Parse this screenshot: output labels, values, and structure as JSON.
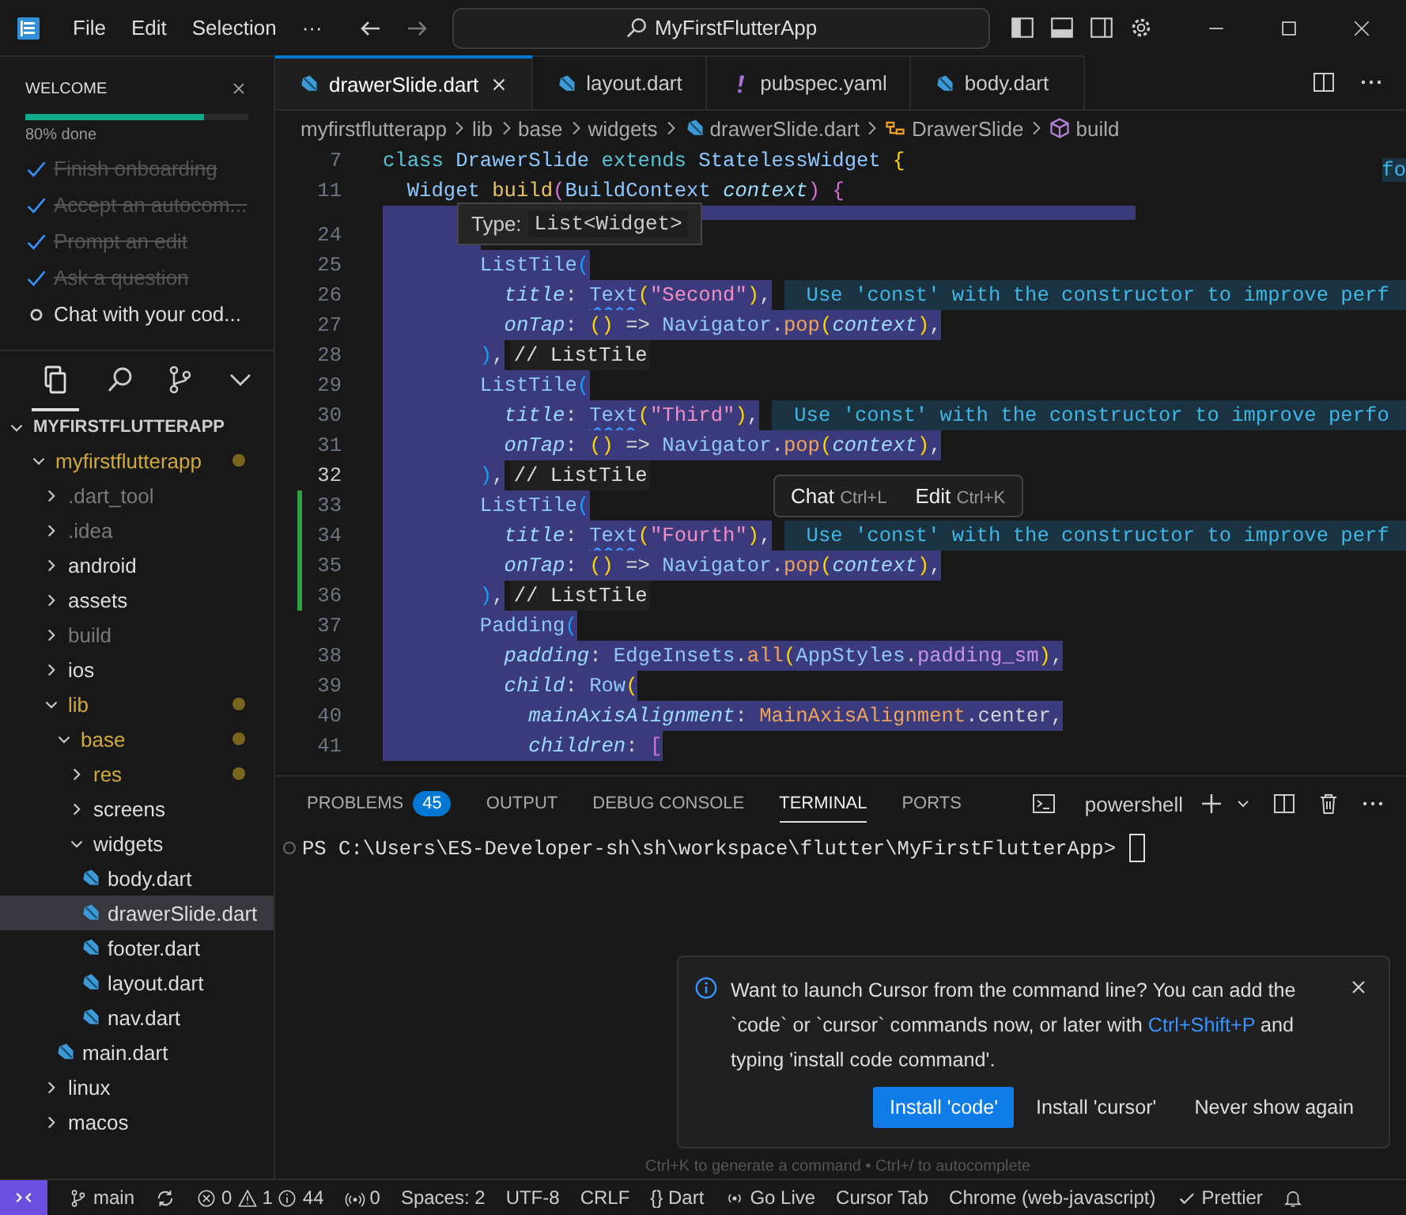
{
  "titlebar": {
    "menu": [
      "File",
      "Edit",
      "Selection",
      "···"
    ],
    "search": "MyFirstFlutterApp"
  },
  "welcome": {
    "title": "WELCOME",
    "level": 0.8,
    "progress_text": "80% done",
    "steps": [
      {
        "label": "Finish onboarding",
        "done": true
      },
      {
        "label": "Accept an autocom...",
        "done": true
      },
      {
        "label": "Prompt an edit",
        "done": true
      },
      {
        "label": "Ask a question",
        "done": true
      },
      {
        "label": "Chat with your cod...",
        "done": false
      }
    ]
  },
  "activity": [
    {
      "kind": "files",
      "selected": true
    },
    {
      "kind": "search",
      "selected": false
    },
    {
      "kind": "git",
      "selected": false
    },
    {
      "kind": "more",
      "selected": false
    }
  ],
  "explorer": {
    "root": "MYFIRSTFLUTTERAPP",
    "tree": [
      {
        "label": "myfirstflutterapp",
        "kind": "folder",
        "expanded": true,
        "modified": true,
        "dimmed": false,
        "selected": false,
        "children": [
          {
            "label": ".dart_tool",
            "kind": "folder",
            "expanded": false,
            "modified": false,
            "dimmed": true,
            "selected": false
          },
          {
            "label": ".idea",
            "kind": "folder",
            "expanded": false,
            "modified": false,
            "dimmed": true,
            "selected": false
          },
          {
            "label": "android",
            "kind": "folder",
            "expanded": false,
            "modified": false,
            "dimmed": false,
            "selected": false
          },
          {
            "label": "assets",
            "kind": "folder",
            "expanded": false,
            "modified": false,
            "dimmed": false,
            "selected": false
          },
          {
            "label": "build",
            "kind": "folder",
            "expanded": false,
            "modified": false,
            "dimmed": true,
            "selected": false
          },
          {
            "label": "ios",
            "kind": "folder",
            "expanded": false,
            "modified": false,
            "dimmed": false,
            "selected": false
          },
          {
            "label": "lib",
            "kind": "folder",
            "expanded": true,
            "modified": true,
            "dimmed": false,
            "selected": false,
            "children": [
              {
                "label": "base",
                "kind": "folder",
                "expanded": true,
                "modified": true,
                "dimmed": false,
                "selected": false,
                "children": [
                  {
                    "label": "res",
                    "kind": "folder",
                    "expanded": false,
                    "modified": true,
                    "dimmed": false,
                    "selected": false
                  },
                  {
                    "label": "screens",
                    "kind": "folder",
                    "expanded": false,
                    "modified": false,
                    "dimmed": false,
                    "selected": false
                  },
                  {
                    "label": "widgets",
                    "kind": "folder",
                    "expanded": true,
                    "modified": false,
                    "dimmed": false,
                    "selected": false,
                    "children": [
                      {
                        "label": "body.dart",
                        "kind": "file",
                        "modified": false,
                        "dimmed": false,
                        "selected": false
                      },
                      {
                        "label": "drawerSlide.dart",
                        "kind": "file",
                        "modified": false,
                        "dimmed": false,
                        "selected": true
                      },
                      {
                        "label": "footer.dart",
                        "kind": "file",
                        "modified": false,
                        "dimmed": false,
                        "selected": false
                      },
                      {
                        "label": "layout.dart",
                        "kind": "file",
                        "modified": false,
                        "dimmed": false,
                        "selected": false
                      },
                      {
                        "label": "nav.dart",
                        "kind": "file",
                        "modified": false,
                        "dimmed": false,
                        "selected": false
                      }
                    ]
                  }
                ]
              },
              {
                "label": "main.dart",
                "kind": "file",
                "modified": false,
                "dimmed": false,
                "selected": false
              }
            ]
          },
          {
            "label": "linux",
            "kind": "folder",
            "expanded": false,
            "modified": false,
            "dimmed": false,
            "selected": false
          },
          {
            "label": "macos",
            "kind": "folder",
            "expanded": false,
            "modified": false,
            "dimmed": false,
            "selected": false
          }
        ]
      }
    ]
  },
  "tabs": [
    {
      "label": "drawerSlide.dart",
      "kind": "dart",
      "selected": true
    },
    {
      "label": "layout.dart",
      "kind": "dart",
      "selected": false
    },
    {
      "label": "pubspec.yaml",
      "kind": "yaml",
      "selected": false
    },
    {
      "label": "body.dart",
      "kind": "dart",
      "selected": false
    }
  ],
  "breadcrumbs": [
    {
      "label": "myfirstflutterapp",
      "kind": "folder"
    },
    {
      "label": "lib",
      "kind": "folder"
    },
    {
      "label": "base",
      "kind": "folder"
    },
    {
      "label": "widgets",
      "kind": "folder"
    },
    {
      "label": "drawerSlide.dart",
      "kind": "file"
    },
    {
      "label": "DrawerSlide",
      "kind": "class"
    },
    {
      "label": "build",
      "kind": "method"
    }
  ],
  "editor": {
    "sticky": [
      {
        "number": "7",
        "segments": [
          {
            "text": "class ",
            "kind": "kw"
          },
          {
            "text": "DrawerSlide ",
            "kind": "type"
          },
          {
            "text": "extends ",
            "kind": "kw"
          },
          {
            "text": "StatelessWidget ",
            "kind": "type"
          },
          {
            "text": "{",
            "kind": "br1"
          }
        ]
      },
      {
        "number": "11",
        "segments": [
          {
            "text": "  Widget ",
            "kind": "type"
          },
          {
            "text": "build",
            "kind": "fn"
          },
          {
            "text": "(",
            "kind": "br2"
          },
          {
            "text": "BuildContext ",
            "kind": "type"
          },
          {
            "text": "context",
            "kind": "param"
          },
          {
            "text": ")",
            "kind": "br2"
          },
          {
            "text": " {",
            "kind": "br2"
          }
        ]
      }
    ],
    "lines": [
      {
        "number": "24",
        "selected": true,
        "current": false,
        "changed": false
      },
      {
        "number": "25",
        "selected": true,
        "current": false,
        "changed": false,
        "segments": [
          {
            "text": "        ListTile",
            "kind": "type"
          },
          {
            "text": "(",
            "kind": "br3"
          }
        ]
      },
      {
        "number": "26",
        "selected": true,
        "current": false,
        "changed": false,
        "segments": [
          {
            "text": "          title",
            "kind": "param"
          },
          {
            "text": ": ",
            "kind": "plain"
          },
          {
            "text": "Text",
            "kind": "warn"
          },
          {
            "text": "(",
            "kind": "br1"
          },
          {
            "text": "\"Second\"",
            "kind": "str"
          },
          {
            "text": ")",
            "kind": "br1"
          },
          {
            "text": ",",
            "kind": "plain"
          }
        ],
        "hint": "Use 'const' with the constructor to improve perf"
      },
      {
        "number": "27",
        "selected": true,
        "current": false,
        "changed": false,
        "segments": [
          {
            "text": "          onTap",
            "kind": "param"
          },
          {
            "text": ": ",
            "kind": "plain"
          },
          {
            "text": "()",
            "kind": "br1"
          },
          {
            "text": " => ",
            "kind": "plain"
          },
          {
            "text": "Navigator",
            "kind": "type"
          },
          {
            "text": ".",
            "kind": "plain"
          },
          {
            "text": "pop",
            "kind": "fn2"
          },
          {
            "text": "(",
            "kind": "br1"
          },
          {
            "text": "context",
            "kind": "param"
          },
          {
            "text": ")",
            "kind": "br1"
          },
          {
            "text": ",",
            "kind": "plain"
          }
        ]
      },
      {
        "number": "28",
        "selected": true,
        "current": false,
        "changed": false,
        "segments": [
          {
            "text": "        )",
            "kind": "br3"
          },
          {
            "text": ",",
            "kind": "plain"
          }
        ],
        "inlay": "// ListTile"
      },
      {
        "number": "29",
        "selected": true,
        "current": false,
        "changed": false,
        "segments": [
          {
            "text": "        ListTile",
            "kind": "type"
          },
          {
            "text": "(",
            "kind": "br3"
          }
        ]
      },
      {
        "number": "30",
        "selected": true,
        "current": false,
        "changed": false,
        "segments": [
          {
            "text": "          title",
            "kind": "param"
          },
          {
            "text": ": ",
            "kind": "plain"
          },
          {
            "text": "Text",
            "kind": "warn"
          },
          {
            "text": "(",
            "kind": "br1"
          },
          {
            "text": "\"Third\"",
            "kind": "str"
          },
          {
            "text": ")",
            "kind": "br1"
          },
          {
            "text": ",",
            "kind": "plain"
          }
        ],
        "hint": "Use 'const' with the constructor to improve perfo"
      },
      {
        "number": "31",
        "selected": true,
        "current": false,
        "changed": false,
        "segments": [
          {
            "text": "          onTap",
            "kind": "param"
          },
          {
            "text": ": ",
            "kind": "plain"
          },
          {
            "text": "()",
            "kind": "br1"
          },
          {
            "text": " => ",
            "kind": "plain"
          },
          {
            "text": "Navigator",
            "kind": "type"
          },
          {
            "text": ".",
            "kind": "plain"
          },
          {
            "text": "pop",
            "kind": "fn2"
          },
          {
            "text": "(",
            "kind": "br1"
          },
          {
            "text": "context",
            "kind": "param"
          },
          {
            "text": ")",
            "kind": "br1"
          },
          {
            "text": ",",
            "kind": "plain"
          }
        ]
      },
      {
        "number": "32",
        "selected": true,
        "current": true,
        "changed": false,
        "segments": [
          {
            "text": "        )",
            "kind": "br3"
          },
          {
            "text": ",",
            "kind": "plain"
          }
        ],
        "inlay": "// ListTile"
      },
      {
        "number": "33",
        "selected": true,
        "current": false,
        "changed": true,
        "segments": [
          {
            "text": "        ListTile",
            "kind": "type"
          },
          {
            "text": "(",
            "kind": "br3"
          }
        ]
      },
      {
        "number": "34",
        "selected": true,
        "current": false,
        "changed": true,
        "segments": [
          {
            "text": "          title",
            "kind": "param"
          },
          {
            "text": ": ",
            "kind": "plain"
          },
          {
            "text": "Text",
            "kind": "warn"
          },
          {
            "text": "(",
            "kind": "br1"
          },
          {
            "text": "\"Fourth\"",
            "kind": "str"
          },
          {
            "text": ")",
            "kind": "br1"
          },
          {
            "text": ",",
            "kind": "plain"
          }
        ],
        "hint": "Use 'const' with the constructor to improve perf"
      },
      {
        "number": "35",
        "selected": true,
        "current": false,
        "changed": true,
        "segments": [
          {
            "text": "          onTap",
            "kind": "param"
          },
          {
            "text": ": ",
            "kind": "plain"
          },
          {
            "text": "()",
            "kind": "br1"
          },
          {
            "text": " => ",
            "kind": "plain"
          },
          {
            "text": "Navigator",
            "kind": "type"
          },
          {
            "text": ".",
            "kind": "plain"
          },
          {
            "text": "pop",
            "kind": "fn2"
          },
          {
            "text": "(",
            "kind": "br1"
          },
          {
            "text": "context",
            "kind": "param"
          },
          {
            "text": ")",
            "kind": "br1"
          },
          {
            "text": ",",
            "kind": "plain"
          }
        ]
      },
      {
        "number": "36",
        "selected": true,
        "current": false,
        "changed": true,
        "segments": [
          {
            "text": "        )",
            "kind": "br3"
          },
          {
            "text": ",",
            "kind": "plain"
          }
        ],
        "inlay": "// ListTile"
      },
      {
        "number": "37",
        "selected": true,
        "current": false,
        "changed": false,
        "segments": [
          {
            "text": "        Padding",
            "kind": "type"
          },
          {
            "text": "(",
            "kind": "br3"
          }
        ]
      },
      {
        "number": "38",
        "selected": true,
        "current": false,
        "changed": false,
        "segments": [
          {
            "text": "          padding",
            "kind": "param"
          },
          {
            "text": ": ",
            "kind": "plain"
          },
          {
            "text": "EdgeInsets",
            "kind": "type"
          },
          {
            "text": ".",
            "kind": "plain"
          },
          {
            "text": "all",
            "kind": "fn2"
          },
          {
            "text": "(",
            "kind": "br1"
          },
          {
            "text": "AppStyles",
            "kind": "type"
          },
          {
            "text": ".",
            "kind": "plain"
          },
          {
            "text": "padding_sm",
            "kind": "prop"
          },
          {
            "text": ")",
            "kind": "br1"
          },
          {
            "text": ",",
            "kind": "plain"
          }
        ]
      },
      {
        "number": "39",
        "selected": true,
        "current": false,
        "changed": false,
        "segments": [
          {
            "text": "          child",
            "kind": "param"
          },
          {
            "text": ": ",
            "kind": "plain"
          },
          {
            "text": "Row",
            "kind": "type"
          },
          {
            "text": "(",
            "kind": "br1"
          }
        ]
      },
      {
        "number": "40",
        "selected": true,
        "current": false,
        "changed": false,
        "segments": [
          {
            "text": "            mainAxisAlignment",
            "kind": "param"
          },
          {
            "text": ": ",
            "kind": "plain"
          },
          {
            "text": "MainAxisAlignment",
            "kind": "enum"
          },
          {
            "text": ".center,",
            "kind": "plain"
          }
        ]
      },
      {
        "number": "41",
        "selected": true,
        "current": false,
        "changed": false,
        "segments": [
          {
            "text": "            children",
            "kind": "param"
          },
          {
            "text": ": ",
            "kind": "plain"
          },
          {
            "text": "[",
            "kind": "br2"
          }
        ]
      }
    ],
    "peek_text": "fo",
    "hover": {
      "label": "Type:",
      "value": "List<Widget>"
    },
    "inline_actions": [
      {
        "label": "Chat",
        "shortcut": "Ctrl+L"
      },
      {
        "label": "Edit",
        "shortcut": "Ctrl+K"
      }
    ]
  },
  "panel": {
    "tabs": [
      {
        "label": "PROBLEMS",
        "badge": "45",
        "selected": false
      },
      {
        "label": "OUTPUT",
        "selected": false
      },
      {
        "label": "DEBUG CONSOLE",
        "selected": false
      },
      {
        "label": "TERMINAL",
        "selected": true
      },
      {
        "label": "PORTS",
        "selected": false
      }
    ],
    "shell": "powershell",
    "prompt": "PS C:\\Users\\ES-Developer-sh\\sh\\workspace\\flutter\\MyFirstFlutterApp>",
    "hint": "Ctrl+K to generate a command • Ctrl+/ to autocomplete"
  },
  "notification": {
    "before": "Want to launch Cursor from the command line? You can add the `code` or `cursor` commands now, or later with ",
    "link": "Ctrl+Shift+P",
    "after": " and typing 'install code command'.",
    "buttons": [
      {
        "label": "Install 'code'",
        "kind": "primary"
      },
      {
        "label": "Install 'cursor'",
        "kind": "secondary"
      },
      {
        "label": "Never show again",
        "kind": "secondary"
      }
    ]
  },
  "status_bar": [
    {
      "kind": "remote"
    },
    {
      "kind": "branch",
      "label": "main"
    },
    {
      "kind": "sync"
    },
    {
      "kind": "problems",
      "errors": "0",
      "warnings": "1",
      "infos": "44"
    },
    {
      "kind": "ports",
      "label": "0"
    },
    {
      "kind": "text",
      "label": "Spaces: 2"
    },
    {
      "kind": "text",
      "label": "UTF-8"
    },
    {
      "kind": "text",
      "label": "CRLF"
    },
    {
      "kind": "text",
      "label": "{} Dart"
    },
    {
      "kind": "live",
      "label": "Go Live"
    },
    {
      "kind": "text",
      "label": "Cursor Tab"
    },
    {
      "kind": "text",
      "label": "Chrome (web-javascript)"
    },
    {
      "kind": "check",
      "label": "Prettier"
    },
    {
      "kind": "bell"
    }
  ]
}
